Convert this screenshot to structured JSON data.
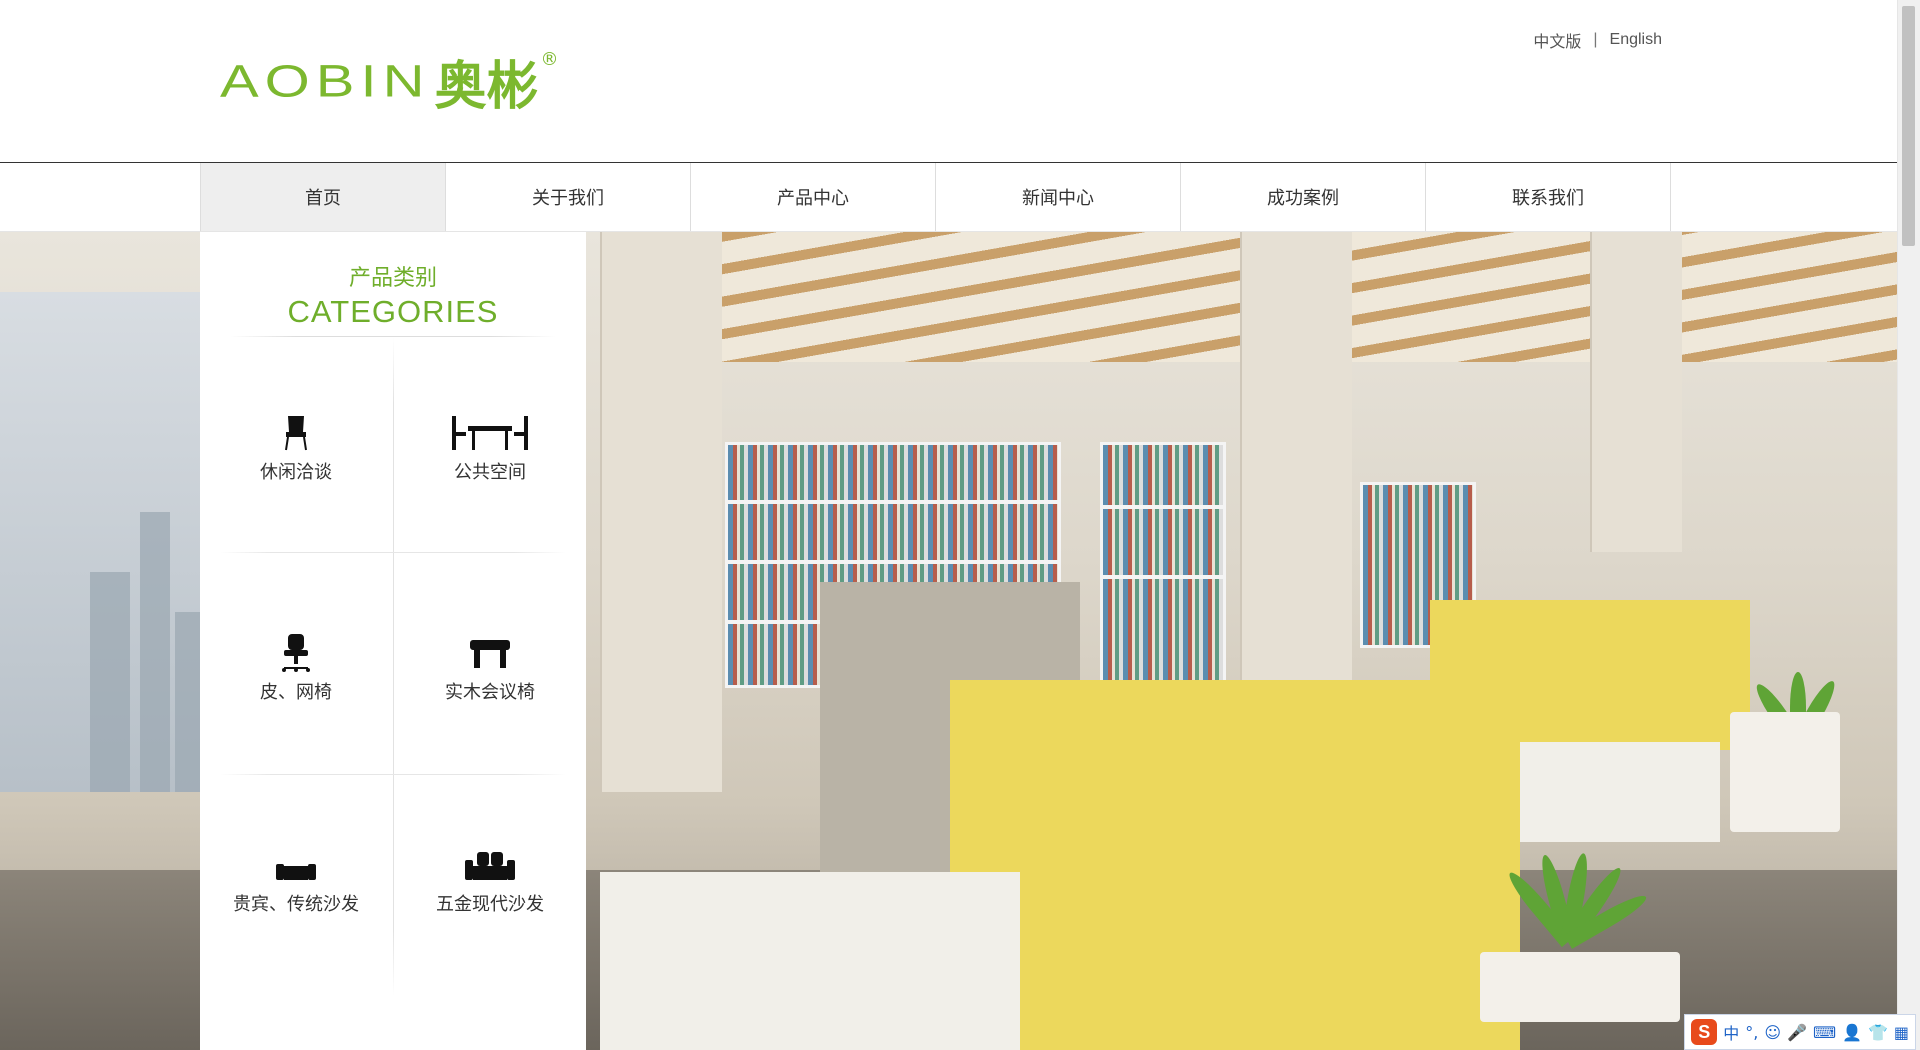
{
  "header": {
    "logo_latin": "AOBIN",
    "logo_cn": "奥彬",
    "logo_reg": "®",
    "lang": {
      "cn": "中文版",
      "sep": "|",
      "en": "English"
    }
  },
  "nav": {
    "items": [
      {
        "label": "首页"
      },
      {
        "label": "关于我们"
      },
      {
        "label": "产品中心"
      },
      {
        "label": "新闻中心"
      },
      {
        "label": "成功案例"
      },
      {
        "label": "联系我们"
      }
    ]
  },
  "categories": {
    "title_cn": "产品类别",
    "title_en": "CATEGORIES",
    "items": [
      {
        "label": "休闲洽谈",
        "icon": "chair-icon"
      },
      {
        "label": "公共空间",
        "icon": "table-chairs-icon"
      },
      {
        "label": "皮、网椅",
        "icon": "office-chair-icon"
      },
      {
        "label": "实木会议椅",
        "icon": "stool-icon"
      },
      {
        "label": "贵宾、传统沙发",
        "icon": "sofa-icon"
      },
      {
        "label": "五金现代沙发",
        "icon": "modern-sofa-icon"
      }
    ]
  },
  "ime": {
    "logo": "S",
    "mode": "中",
    "punct": "°,",
    "emoji": "☺",
    "mic": "🎤",
    "keyboard": "⌨",
    "user": "👤",
    "skin": "👕",
    "menu": "▦"
  },
  "colors": {
    "brand": "#7cb82f",
    "nav_active": "#eeeeee"
  }
}
